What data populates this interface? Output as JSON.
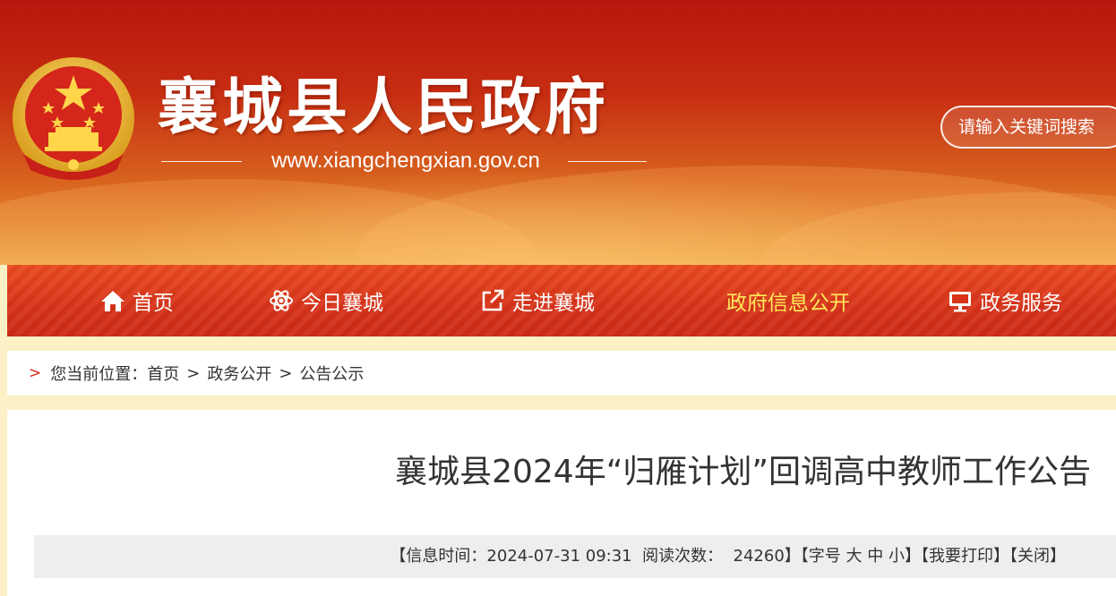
{
  "header": {
    "site_title": "襄城县人民政府",
    "site_url": "www.xiangchengxian.gov.cn",
    "search_placeholder": "请输入关键词搜索"
  },
  "nav": {
    "items": [
      {
        "label": "首页",
        "icon": "home-icon"
      },
      {
        "label": "今日襄城",
        "icon": "atom-icon"
      },
      {
        "label": "走进襄城",
        "icon": "external-link-icon"
      },
      {
        "label": "政府信息公开",
        "icon": "",
        "active": true
      },
      {
        "label": "政务服务",
        "icon": "monitor-icon"
      }
    ],
    "active_color": "#ffe95a"
  },
  "breadcrumb": {
    "prefix": "您当前位置：",
    "items": [
      "首页",
      "政务公开",
      "公告公示"
    ],
    "separator": ">"
  },
  "article": {
    "title": "襄城县2024年“归雁计划”回调高中教师工作公告",
    "meta": {
      "time_label": "【信息时间：",
      "time_value": "2024-07-31 09:31",
      "views_label": "阅读次数：",
      "views_value": "24260",
      "views_close": "】",
      "font_size_label": "【字号",
      "font_large": "大",
      "font_medium": "中",
      "font_small": "小",
      "font_close": "】",
      "print": "【我要打印】",
      "close": "【关闭】"
    }
  },
  "colors": {
    "brand_red": "#c62d12",
    "nav_red": "#d8341a",
    "page_bg": "#fbf0c6"
  }
}
